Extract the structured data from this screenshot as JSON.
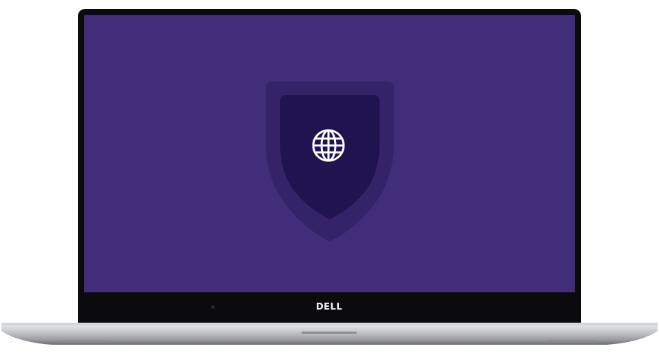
{
  "device": {
    "brand_logo": "DELL"
  },
  "screen": {
    "background_color": "#412d7a",
    "icon": "shield-globe-icon",
    "shield_outer_color": "#35236a",
    "shield_inner_color": "#1f1450",
    "globe_color": "#ffffff"
  }
}
